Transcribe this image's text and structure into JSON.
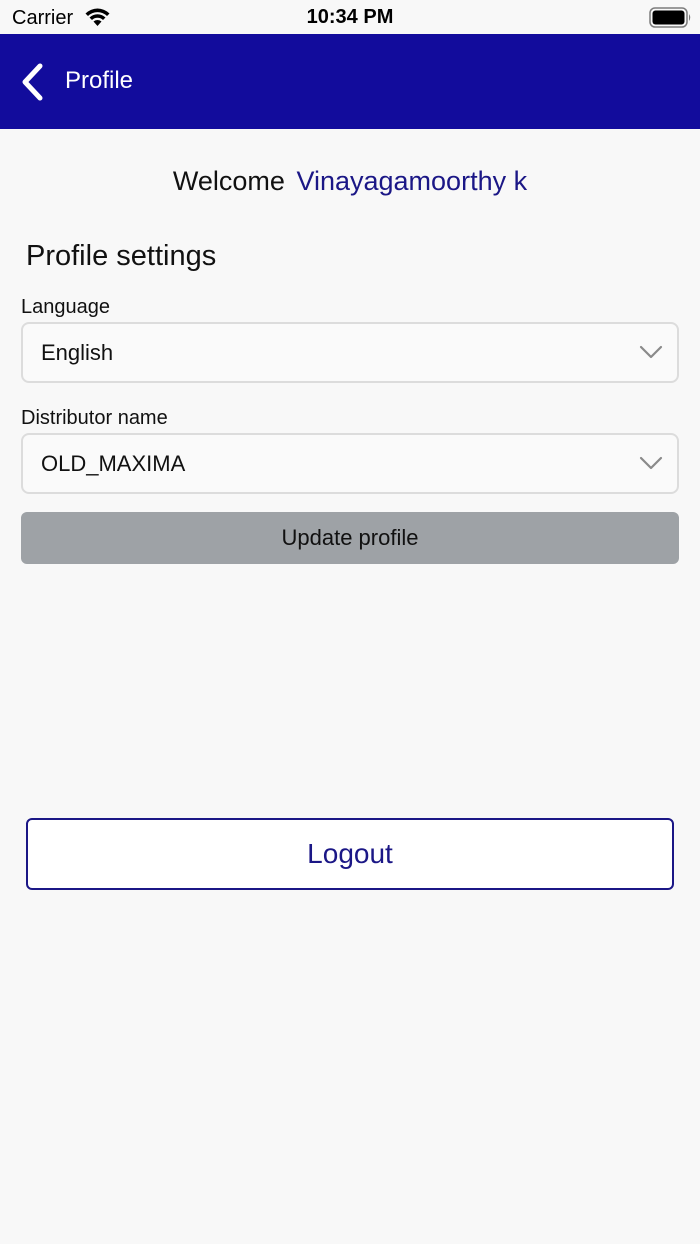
{
  "status_bar": {
    "carrier": "Carrier",
    "time": "10:34 PM"
  },
  "nav": {
    "title": "Profile",
    "back_icon": "chevron-left-icon"
  },
  "welcome": {
    "label": "Welcome",
    "user_name": "Vinayagamoorthy k"
  },
  "profile_settings": {
    "title": "Profile settings",
    "language": {
      "label": "Language",
      "value": "English"
    },
    "distributor": {
      "label": "Distributor name",
      "value": "OLD_MAXIMA"
    },
    "update_label": "Update profile"
  },
  "logout_label": "Logout",
  "colors": {
    "nav_background": "#120c9c",
    "accent": "#1b1786",
    "button_gray": "#9ea2a6",
    "background": "#f8f8f8"
  }
}
